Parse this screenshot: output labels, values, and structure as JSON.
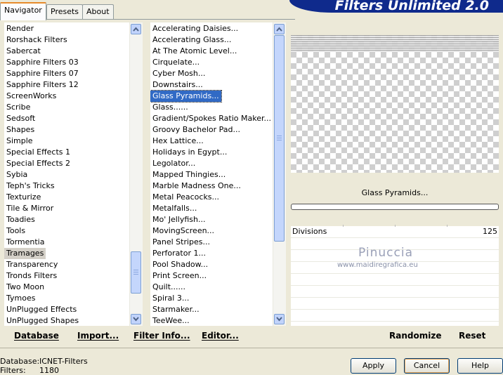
{
  "tabs": [
    "Navigator",
    "Presets",
    "About"
  ],
  "app_title": "Filters Unlimited 2.0",
  "categories": [
    "Render",
    "Rorshack Filters",
    "Sabercat",
    "Sapphire Filters 03",
    "Sapphire Filters 07",
    "Sapphire Filters 12",
    "ScreenWorks",
    "Scribe",
    "Sedsoft",
    "Shapes",
    "Simple",
    "Special Effects 1",
    "Special Effects 2",
    "Sybia",
    "Teph's Tricks",
    "Texturize",
    "Tile & Mirror",
    "Toadies",
    "Tools",
    "Tormentia",
    "Tramages",
    "Transparency",
    "Tronds Filters",
    "Two Moon",
    "Tymoes",
    "UnPlugged Effects",
    "UnPlugged Shapes"
  ],
  "selected_category": "Tramages",
  "filters": [
    "Accelerating Daisies...",
    "Accelerating Glass...",
    "At The Atomic Level...",
    "Cirquelate...",
    "Cyber Mosh...",
    "Downstairs...",
    "Glass Pyramids...",
    "Glass......",
    "Gradient/Spokes Ratio Maker...",
    "Groovy Bachelor Pad...",
    "Hex Lattice...",
    "Holidays in Egypt...",
    "Legolator...",
    "Mapped Thingies...",
    "Marble Madness One...",
    "Metal Peacocks...",
    "Metalfalls...",
    "Mo' Jellyfish...",
    "MovingScreen...",
    "Panel Stripes...",
    "Perforator 1...",
    "Pool Shadow...",
    "Print Screen...",
    "Quilt......",
    "Spiral 3...",
    "Starmaker...",
    "TeeWee..."
  ],
  "selected_filter": "Glass Pyramids...",
  "current_filter_name": "Glass Pyramids...",
  "parameters": [
    {
      "label": "Divisions",
      "value": "125"
    }
  ],
  "watermark": {
    "name": "Pinuccia",
    "url": "www.maidiregrafica.eu"
  },
  "bottom_links": {
    "database": "Database",
    "import": "Import...",
    "filter_info": "Filter Info...",
    "editor": "Editor...",
    "randomize": "Randomize",
    "reset": "Reset"
  },
  "status": {
    "database_label": "Database:",
    "database_value": "ICNET-Filters",
    "filters_label": "Filters:",
    "filters_value": "1180"
  },
  "buttons": {
    "apply": "Apply",
    "cancel": "Cancel",
    "help": "Help"
  },
  "colors": {
    "banner": "#0f2a8c",
    "selection": "#316ac5",
    "accent": "#e68b2c"
  }
}
